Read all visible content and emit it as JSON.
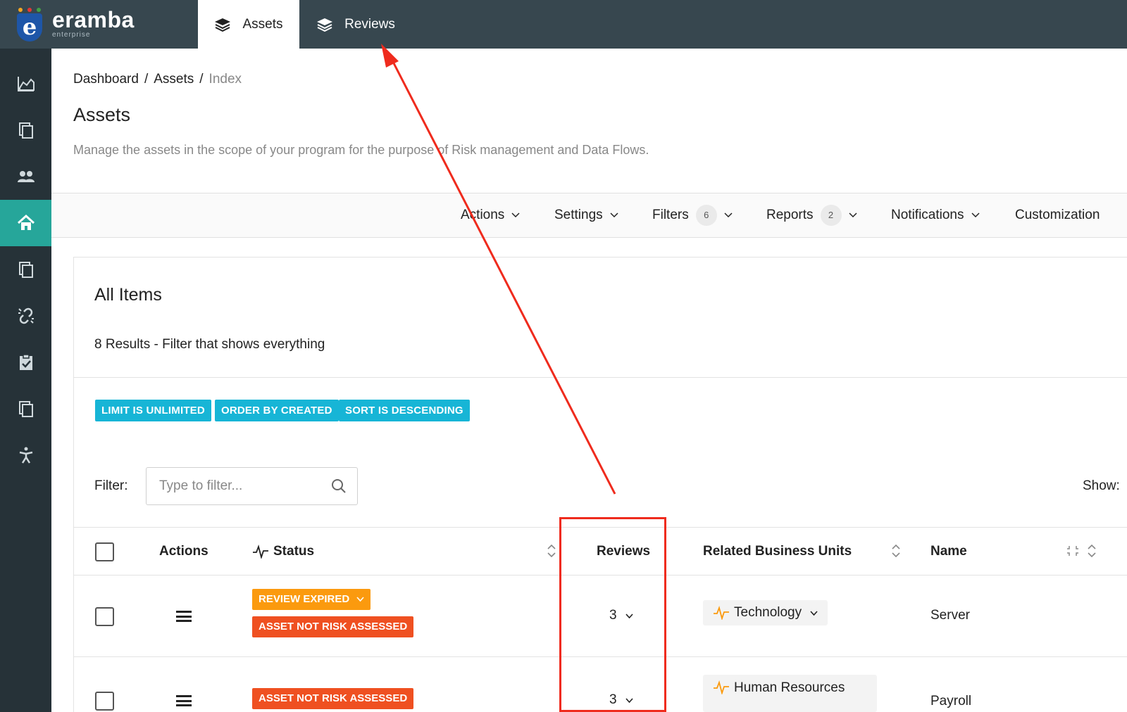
{
  "app": {
    "logo_name": "eramba",
    "logo_sub": "enterprise"
  },
  "top_tabs": [
    {
      "label": "Assets",
      "active": true
    },
    {
      "label": "Reviews",
      "active": false
    }
  ],
  "sidebar": {
    "items": [
      {
        "icon": "chart-icon"
      },
      {
        "icon": "copy-icon"
      },
      {
        "icon": "users-icon"
      },
      {
        "icon": "home-icon",
        "active": true
      },
      {
        "icon": "copy-icon"
      },
      {
        "icon": "broken-link-icon"
      },
      {
        "icon": "clipboard-check-icon"
      },
      {
        "icon": "copy-icon"
      },
      {
        "icon": "accessibility-icon"
      }
    ]
  },
  "breadcrumb": {
    "items": [
      "Dashboard",
      "Assets",
      "Index"
    ],
    "separator": "/"
  },
  "page": {
    "title": "Assets",
    "description": "Manage the assets in the scope of your program for the purpose of Risk management and Data Flows."
  },
  "toolbar": {
    "actions": "Actions",
    "settings": "Settings",
    "filters": "Filters",
    "filters_count": "6",
    "reports": "Reports",
    "reports_count": "2",
    "notifications": "Notifications",
    "customization": "Customization"
  },
  "panel": {
    "title": "All Items",
    "subtitle": "8 Results - Filter that shows everything",
    "pills": [
      "LIMIT IS UNLIMITED",
      "ORDER BY CREATED",
      "SORT IS DESCENDING"
    ],
    "filter_label": "Filter:",
    "filter_placeholder": "Type to filter...",
    "show_label": "Show:"
  },
  "table": {
    "columns": [
      "Actions",
      "Status",
      "Reviews",
      "Related Business Units",
      "Name"
    ],
    "rows": [
      {
        "statuses": [
          {
            "label": "REVIEW EXPIRED",
            "color": "#fb9a0e",
            "dropdown": true
          },
          {
            "label": "ASSET NOT RISK ASSESSED",
            "color": "#ef5021",
            "dropdown": false
          }
        ],
        "reviews": "3",
        "business_unit": "Technology",
        "name": "Server"
      },
      {
        "statuses": [
          {
            "label": "ASSET NOT RISK ASSESSED",
            "color": "#ef5021",
            "dropdown": false
          }
        ],
        "reviews": "3",
        "business_unit": "Human Resources",
        "name": "Payroll"
      }
    ]
  },
  "colors": {
    "topbar": "#37474f",
    "sidebar": "#263238",
    "sidebar_active": "#26a69a",
    "pill": "#17b5d6",
    "annotation": "#ef2b1d"
  }
}
